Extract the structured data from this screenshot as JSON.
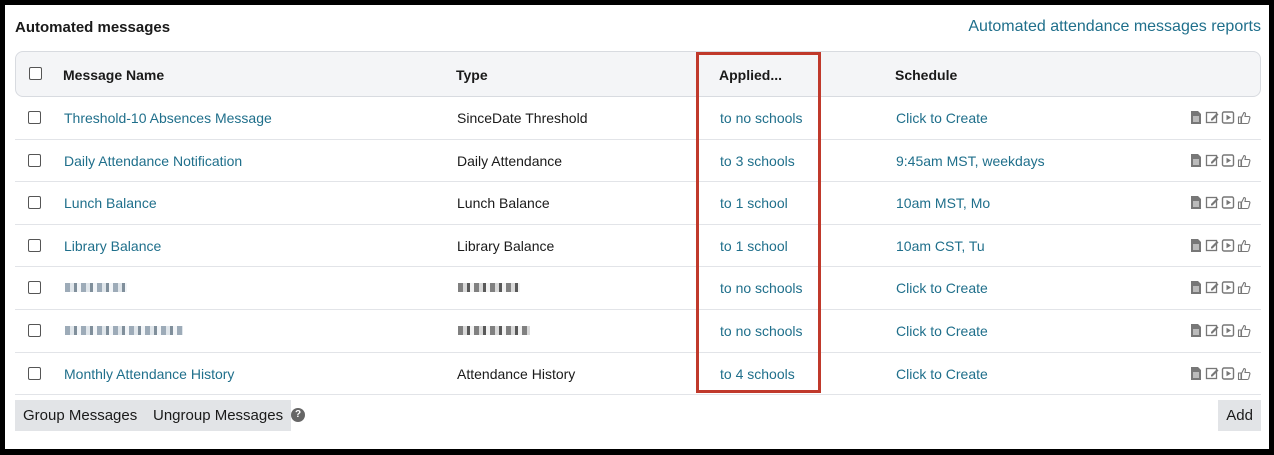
{
  "header": {
    "title": "Automated messages",
    "report_link": "Automated attendance messages reports"
  },
  "table": {
    "columns": [
      "Message Name",
      "Type",
      "Applied...",
      "Schedule"
    ],
    "rows": [
      {
        "name": "Threshold-10 Absences Message",
        "type": "SinceDate Threshold",
        "applied": "to no schools",
        "schedule": "Click to Create"
      },
      {
        "name": "Daily Attendance Notification",
        "type": "Daily Attendance",
        "applied": "to 3 schools",
        "schedule": "9:45am MST, weekdays"
      },
      {
        "name": "Lunch Balance",
        "type": "Lunch Balance",
        "applied": "to 1 school",
        "schedule": "10am MST, Mo"
      },
      {
        "name": "Library Balance",
        "type": "Library Balance",
        "applied": "to 1 school",
        "schedule": "10am CST, Tu"
      },
      {
        "name": "",
        "type": "",
        "applied": "to no schools",
        "schedule": "Click to Create"
      },
      {
        "name": "",
        "type": "",
        "applied": "to no schools",
        "schedule": "Click to Create"
      },
      {
        "name": "Monthly Attendance History",
        "type": "Attendance History",
        "applied": "to 4 schools",
        "schedule": "Click to Create"
      }
    ],
    "row_actions": [
      "document-icon",
      "edit-icon",
      "play-icon",
      "thumbs-up-icon"
    ]
  },
  "footer": {
    "group_label": "Group Messages",
    "ungroup_label": "Ungroup Messages",
    "help_glyph": "?",
    "add_label": "Add"
  },
  "colors": {
    "link": "#1f6f8b",
    "highlight": "#c0392b"
  }
}
